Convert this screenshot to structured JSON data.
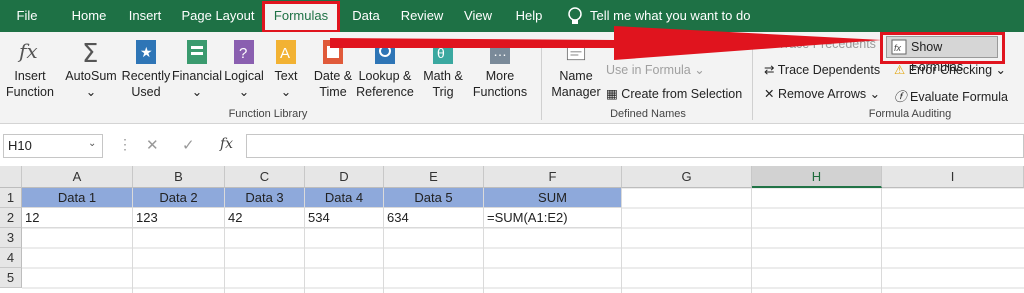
{
  "menu": {
    "file": "File",
    "home": "Home",
    "insert": "Insert",
    "page_layout": "Page Layout",
    "formulas": "Formulas",
    "data": "Data",
    "review": "Review",
    "view": "View",
    "help": "Help",
    "tell_me": "Tell me what you want to do"
  },
  "ribbon": {
    "insert_function": [
      "Insert",
      "Function"
    ],
    "autosum": "AutoSum",
    "recently_used": [
      "Recently",
      "Used"
    ],
    "financial": "Financial",
    "logical": "Logical",
    "text": "Text",
    "date_time": [
      "Date &",
      "Time"
    ],
    "lookup_reference": [
      "Lookup &",
      "Reference"
    ],
    "math_trig": [
      "Math &",
      "Trig"
    ],
    "more_functions": [
      "More",
      "Functions"
    ],
    "function_library": "Function Library",
    "name_manager": [
      "Name",
      "Manager"
    ],
    "use_in_formula": "Use in Formula",
    "create_from_selection": "Create from Selection",
    "defined_names": "Defined Names",
    "trace_precedents": "Trace Precedents",
    "trace_dependents": "Trace Dependents",
    "remove_arrows": "Remove Arrows",
    "show_formulas": "Show Formulas",
    "error_checking": "Error Checking",
    "evaluate_formula": "Evaluate Formula",
    "formula_auditing": "Formula Auditing"
  },
  "formula_bar": {
    "name_box": "H10",
    "fx": "fx",
    "value": ""
  },
  "sheet": {
    "columns": [
      "A",
      "B",
      "C",
      "D",
      "E",
      "F",
      "G",
      "H",
      "I"
    ],
    "rows": [
      "1",
      "2",
      "3",
      "4",
      "5"
    ],
    "row1": [
      "Data 1",
      "Data 2",
      "Data 3",
      "Data 4",
      "Data 5",
      "SUM"
    ],
    "row2": [
      "12",
      "123",
      "42",
      "534",
      "634",
      "=SUM(A1:E2)"
    ]
  },
  "colors": {
    "brand": "#1e7145",
    "highlight": "#e0141e",
    "header_fill": "#8ea9db"
  }
}
